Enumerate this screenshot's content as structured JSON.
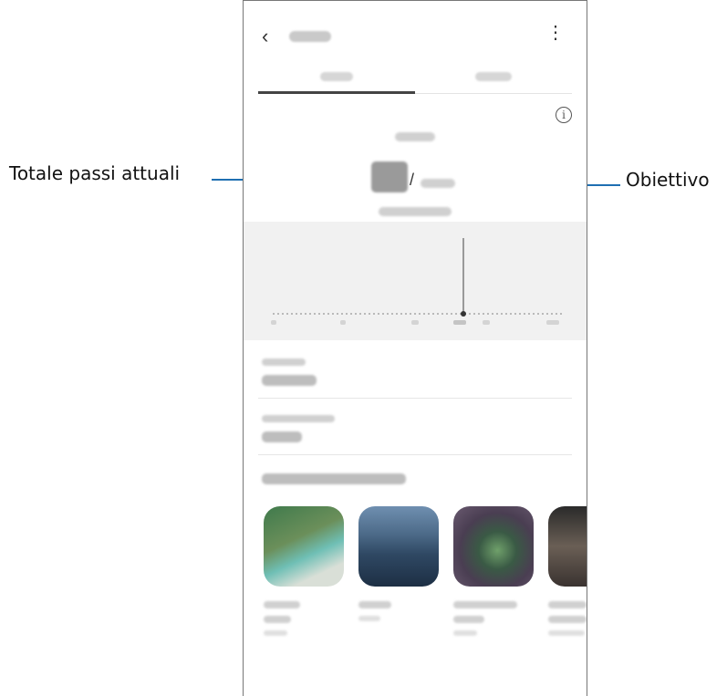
{
  "callouts": {
    "left_label": "Totale passi attuali",
    "right_label": "Obiettivo"
  },
  "header": {
    "back_icon": "chevron-left-icon",
    "more_icon": "more-vert-icon"
  },
  "steps": {
    "separator": "/"
  },
  "colors": {
    "callout_line": "#1f6fb2",
    "chart_bg": "#f1f1f1"
  }
}
